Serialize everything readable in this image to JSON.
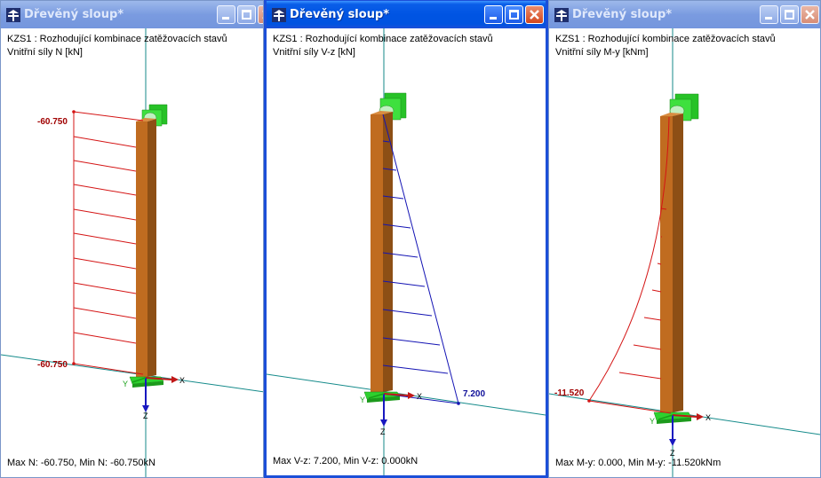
{
  "colors": {
    "member_front": "#b8661e",
    "member_side": "#8a4a12",
    "support": "#2ed12e",
    "axis_line": "#148a8a",
    "normal_diagram": "#d41414",
    "shear_diagram": "#1414b4",
    "moment_diagram": "#d41414",
    "axis_x": "#c01818",
    "axis_y": "#18a018",
    "axis_z": "#1818c0"
  },
  "icons": {
    "app": "wood-column-app-icon",
    "minimize": "minimize-icon",
    "maximize": "maximize-icon",
    "close": "close-icon"
  },
  "windows": [
    {
      "title": "Dřevěný sloup*",
      "active": false,
      "load_case": "KZS1 : Rozhodující kombinace zatěžovacích stavů",
      "result_label": "Vnitřní síly N [kN]",
      "values": {
        "top": "-60.750",
        "bottom": "-60.750"
      },
      "axes": {
        "x": "X",
        "y": "Y",
        "z": "Z"
      },
      "status": "Max N: -60.750, Min N: -60.750kN"
    },
    {
      "title": "Dřevěný sloup*",
      "active": true,
      "load_case": "KZS1 : Rozhodující kombinace zatěžovacích stavů",
      "result_label": "Vnitřní síly V-z [kN]",
      "values": {
        "bottom": "7.200"
      },
      "axes": {
        "x": "X",
        "y": "Y",
        "z": "Z"
      },
      "status": "Max V-z: 7.200, Min V-z: 0.000kN"
    },
    {
      "title": "Dřevěný sloup*",
      "active": false,
      "load_case": "KZS1 : Rozhodující kombinace zatěžovacích stavů",
      "result_label": "Vnitřní síly M-y [kNm]",
      "values": {
        "bottom": "-11.520"
      },
      "axes": {
        "x": "X",
        "y": "Y",
        "z": "Z"
      },
      "status": "Max M-y: 0.000, Min M-y: -11.520kNm"
    }
  ]
}
